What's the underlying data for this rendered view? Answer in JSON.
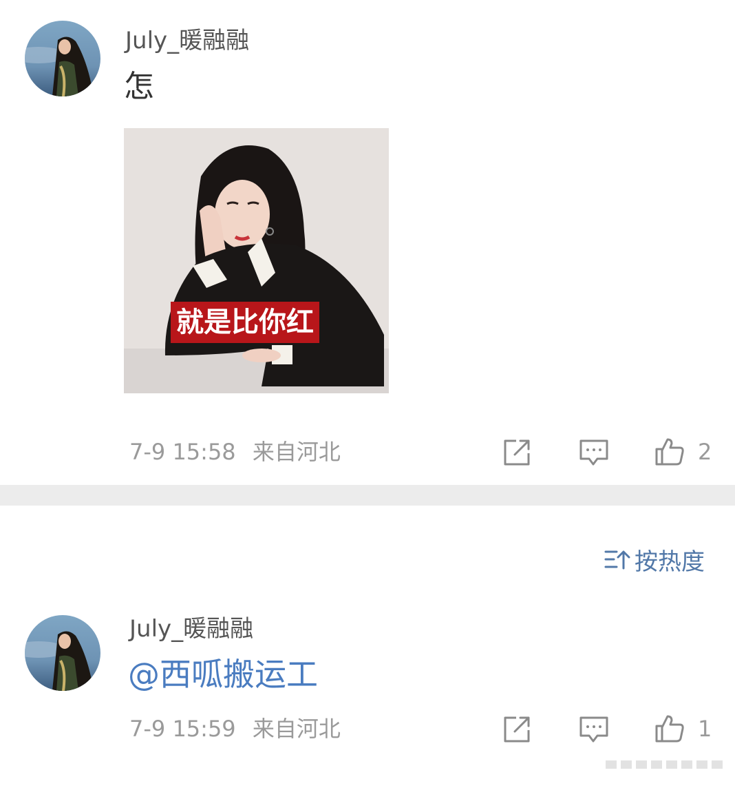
{
  "comments": [
    {
      "username": "July_暖融融",
      "text": "怎",
      "image_caption": "就是比你红",
      "date": "7-9",
      "time": "15:58",
      "location": "来自河北",
      "likes": "2",
      "icons": [
        "share-icon",
        "reply-icon",
        "like-icon"
      ]
    },
    {
      "username": "July_暖融融",
      "text": "@西呱搬运工",
      "date": "7-9",
      "time": "15:59",
      "location": "来自河北",
      "likes": "1",
      "icons": [
        "share-icon",
        "reply-icon",
        "like-icon"
      ]
    }
  ],
  "sort": {
    "label": "按热度",
    "icon": "sort-icon"
  },
  "colors": {
    "mention": "#4a7cc0",
    "sort": "#5278a8",
    "caption_bg": "#b8161a",
    "divider": "#ececec",
    "meta": "#9a9a9a"
  }
}
